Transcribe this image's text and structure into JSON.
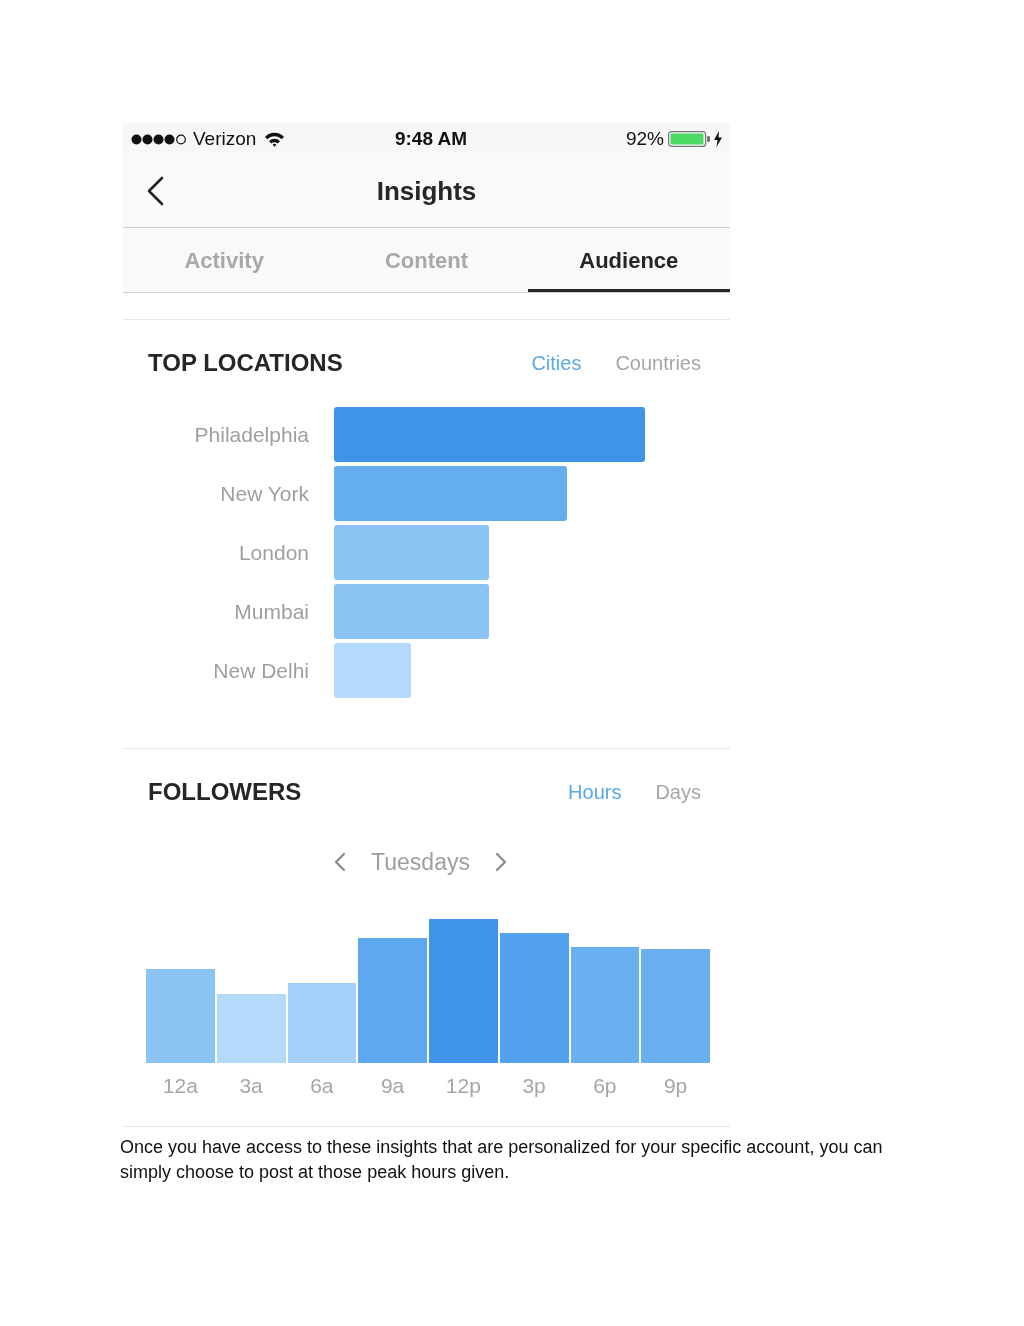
{
  "status_bar": {
    "carrier": "Verizon",
    "time": "9:48 AM",
    "battery": "92%"
  },
  "nav_bar": {
    "title": "Insights"
  },
  "tabs": [
    {
      "label": "Activity",
      "selected": false
    },
    {
      "label": "Content",
      "selected": false
    },
    {
      "label": "Audience",
      "selected": true
    }
  ],
  "top_locations": {
    "title": "TOP LOCATIONS",
    "filters": [
      {
        "label": "Cities",
        "selected": true
      },
      {
        "label": "Countries",
        "selected": false
      }
    ],
    "cities": [
      "Philadelphia",
      "New York",
      "London",
      "Mumbai",
      "New Delhi"
    ]
  },
  "followers": {
    "title": "FOLLOWERS",
    "filters": [
      {
        "label": "Hours",
        "selected": true
      },
      {
        "label": "Days",
        "selected": false
      }
    ],
    "day": "Tuesdays",
    "hours": [
      "12a",
      "3a",
      "6a",
      "9a",
      "12p",
      "3p",
      "6p",
      "9p"
    ]
  },
  "caption": "Once you have access to these insights that are personalized for your specific account, you can simply choose to post at those peak hours given."
}
